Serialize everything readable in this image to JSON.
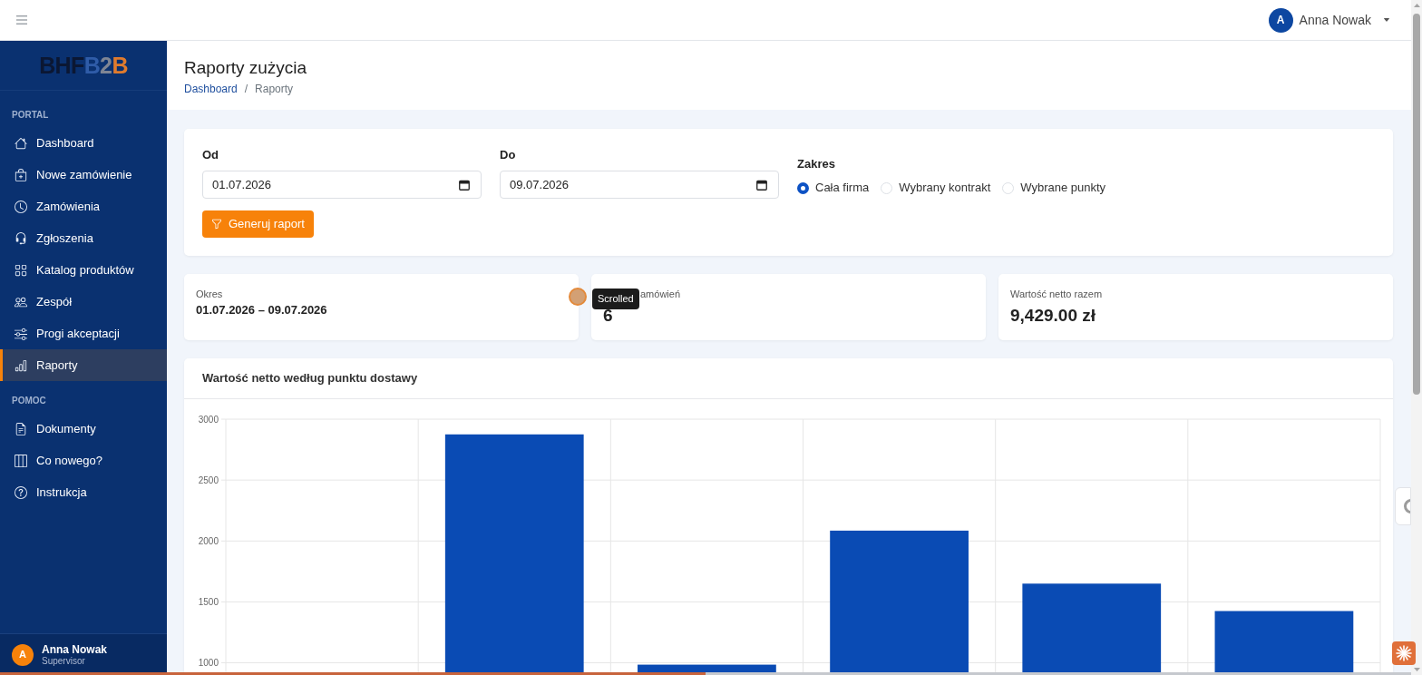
{
  "top_bar": {
    "user": {
      "initial": "A",
      "name": "Anna Nowak"
    }
  },
  "sidebar": {
    "logo": [
      {
        "text": "BHF",
        "color": "#0b1733"
      },
      {
        "text": "B",
        "color": "#2f5ca8"
      },
      {
        "text": "2",
        "color": "#7e8594"
      },
      {
        "text": "B",
        "color": "#e07b2e"
      }
    ],
    "sections": [
      {
        "title": "PORTAL",
        "items": [
          {
            "label": "Dashboard",
            "selected": false
          },
          {
            "label": "Nowe zamówienie",
            "selected": false
          },
          {
            "label": "Zamówienia",
            "selected": false
          },
          {
            "label": "Zgłoszenia",
            "selected": false
          },
          {
            "label": "Katalog produktów",
            "selected": false
          },
          {
            "label": "Zespół",
            "selected": false
          },
          {
            "label": "Progi akceptacji",
            "selected": false
          },
          {
            "label": "Raporty",
            "selected": true
          }
        ]
      },
      {
        "title": "POMOC",
        "items": [
          {
            "label": "Dokumenty",
            "selected": false
          },
          {
            "label": "Co nowego?",
            "selected": false
          },
          {
            "label": "Instrukcja",
            "selected": false
          }
        ]
      }
    ],
    "user": {
      "initial": "A",
      "name": "Anna Nowak",
      "role": "Supervisor"
    }
  },
  "page": {
    "title": "Raporty zużycia",
    "breadcrumb": [
      {
        "label": "Dashboard",
        "kind": "link"
      },
      {
        "label": "/",
        "kind": "separator"
      },
      {
        "label": "Raporty",
        "kind": "current"
      }
    ]
  },
  "filters": {
    "fields": [
      {
        "label": "Od",
        "value": "01.07.2026"
      },
      {
        "label": "Do",
        "value": "09.07.2026"
      }
    ],
    "scope": {
      "label": "Zakres",
      "options": [
        {
          "label": "Cała firma",
          "selected": true
        },
        {
          "label": "Wybrany kontrakt",
          "selected": false
        },
        {
          "label": "Wybrane punkty",
          "selected": false
        }
      ]
    },
    "button": "Generuj raport"
  },
  "stats": [
    {
      "kind": "period",
      "label": "Okres",
      "value": "01.07.2026 – 09.07.2026"
    },
    {
      "kind": "big",
      "label": "amówień",
      "value": "6",
      "tooltip": "Scrolled"
    },
    {
      "kind": "big",
      "label": "Wartość netto razem",
      "value": "9,429.00 zł"
    }
  ],
  "chart": {
    "title": "Wartość netto według punktu dostawy",
    "chart_data": {
      "type": "bar",
      "values": [
        null,
        2875,
        985,
        2085,
        1650,
        1425
      ],
      "ylim": [
        900,
        3000
      ],
      "yticks": [
        1000,
        1500,
        2000,
        2500,
        3000
      ],
      "grid": true
    }
  },
  "progress": {
    "level": 0.5
  }
}
